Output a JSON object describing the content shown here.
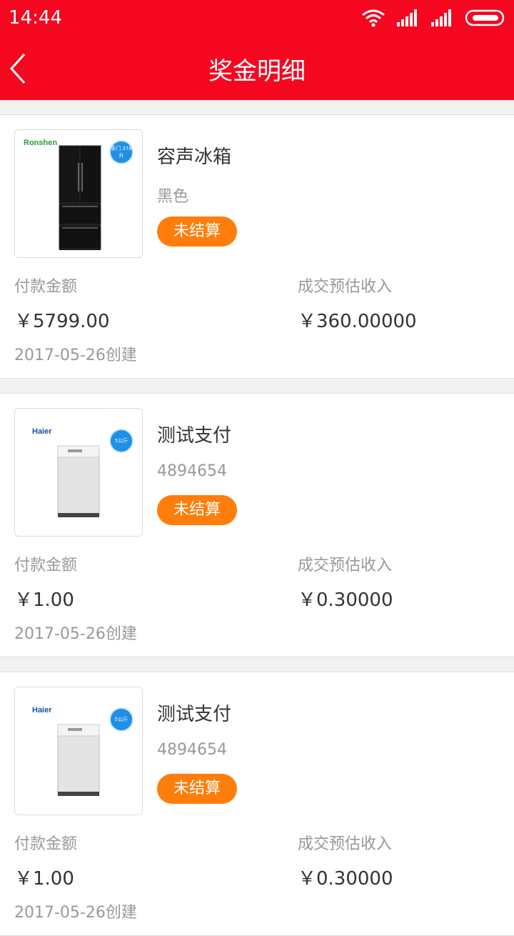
{
  "status_bar": {
    "time": "14:44"
  },
  "header": {
    "title": "奖金明细",
    "accent": "#f5071f"
  },
  "labels": {
    "pay_amount": "付款金额",
    "est_income": "成交预估收入"
  },
  "orders": [
    {
      "brand": "Ronshen",
      "badge": "多门 378升",
      "image": "black-refrigerator",
      "name": "容声冰箱",
      "spec": "黑色",
      "status": "未结算",
      "pay": "￥5799.00",
      "income": "￥360.00000",
      "created": "2017-05-26创建"
    },
    {
      "brand": "Haier",
      "badge": "5公斤",
      "image": "white-washing-machine",
      "name": "测试支付",
      "spec": "4894654",
      "status": "未结算",
      "pay": "￥1.00",
      "income": "￥0.30000",
      "created": "2017-05-26创建"
    },
    {
      "brand": "Haier",
      "badge": "5公斤",
      "image": "white-washing-machine",
      "name": "测试支付",
      "spec": "4894654",
      "status": "未结算",
      "pay": "￥1.00",
      "income": "￥0.30000",
      "created": "2017-05-26创建"
    }
  ]
}
